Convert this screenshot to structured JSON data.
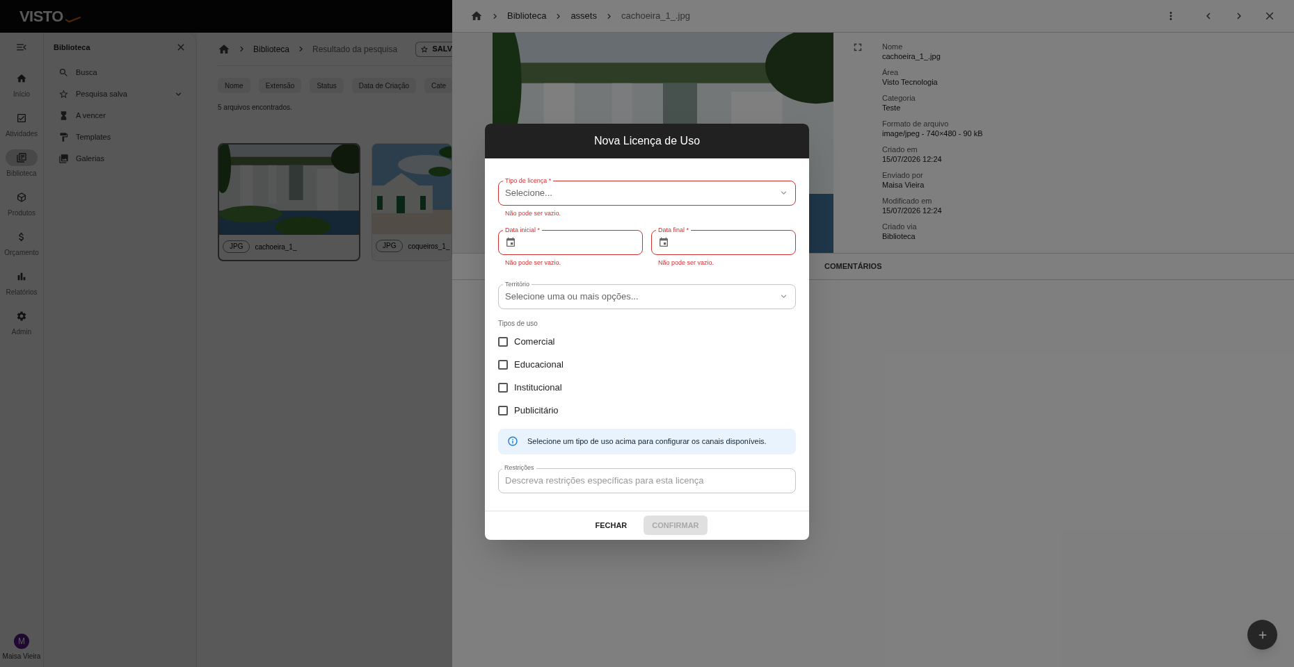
{
  "app": {
    "logo": "VISTO"
  },
  "rail": {
    "items": [
      {
        "label": "Início",
        "selected": false
      },
      {
        "label": "Atividades",
        "selected": false
      },
      {
        "label": "Biblioteca",
        "selected": true
      },
      {
        "label": "Produtos",
        "selected": false
      },
      {
        "label": "Orçamento",
        "selected": false
      },
      {
        "label": "Relatórios",
        "selected": false
      },
      {
        "label": "Admin",
        "selected": false
      }
    ],
    "user": {
      "initial": "M",
      "name": "Maisa Vieira"
    }
  },
  "nav_panel": {
    "title": "Biblioteca",
    "items": [
      {
        "label": "Busca",
        "kind": "link"
      },
      {
        "label": "Pesquisa salva",
        "kind": "group"
      },
      {
        "label": "A vencer",
        "kind": "link"
      },
      {
        "label": "Templates",
        "kind": "link"
      },
      {
        "label": "Galerias",
        "kind": "link"
      }
    ]
  },
  "main": {
    "breadcrumb": [
      "Biblioteca",
      "Resultado da pesquisa"
    ],
    "save_button": "SALV",
    "filters": [
      "Nome",
      "Extensão",
      "Status",
      "Data de Criação",
      "Cate"
    ],
    "result_count": "5 arquivos encontrados.",
    "files": [
      {
        "ext": "JPG",
        "name": "cachoeira_1_",
        "selected": true,
        "kind": "waterfall"
      },
      {
        "ext": "JPG",
        "name": "coqueiros_1_",
        "selected": false,
        "kind": "beach"
      }
    ]
  },
  "drawer": {
    "breadcrumb": [
      "Biblioteca",
      "assets",
      "cachoeira_1_.jpg"
    ],
    "details": [
      {
        "label": "Nome",
        "value": "cachoeira_1_.jpg"
      },
      {
        "label": "Área",
        "value": "Visto Tecnologia"
      },
      {
        "label": "Categoria",
        "value": "Teste"
      },
      {
        "label": "Formato de arquivo",
        "value": "image/jpeg - 740×480 - 90 kB"
      },
      {
        "label": "Criado em",
        "value": "15/07/2026 12:24"
      },
      {
        "label": "Enviado por",
        "value": "Maisa Vieira"
      },
      {
        "label": "Modificado em",
        "value": "15/07/2026 12:24"
      },
      {
        "label": "Criado via",
        "value": "Biblioteca"
      }
    ],
    "tabs": [
      "COMENTÁRIOS"
    ]
  },
  "modal": {
    "title": "Nova Licença de Uso",
    "license_type": {
      "label": "Tipo de licença *",
      "placeholder": "Selecione...",
      "error": "Não pode ser vazio."
    },
    "start_date": {
      "label": "Data inicial *",
      "error": "Não pode ser vazio."
    },
    "end_date": {
      "label": "Data final *",
      "error": "Não pode ser vazio."
    },
    "territory": {
      "label": "Território",
      "placeholder": "Selecione uma ou mais opções..."
    },
    "usage_types": {
      "label": "Tipos de uso",
      "options": [
        {
          "label": "Comercial",
          "checked": false
        },
        {
          "label": "Educacional",
          "checked": false
        },
        {
          "label": "Institucional",
          "checked": false
        },
        {
          "label": "Publicitário",
          "checked": false
        }
      ]
    },
    "info": "Selecione um tipo de uso acima para configurar os canais disponíveis.",
    "restrictions": {
      "label": "Restrições",
      "placeholder": "Descreva restrições específicas para esta licença"
    },
    "buttons": [
      {
        "label": "FECHAR",
        "disabled": false
      },
      {
        "label": "CONFIRMAR",
        "disabled": true
      }
    ]
  }
}
